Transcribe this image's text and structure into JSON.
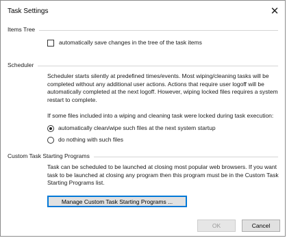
{
  "window": {
    "title": "Task Settings"
  },
  "items_tree": {
    "heading": "Items Tree",
    "autosave_label": "automatically save changes in the tree of the task items"
  },
  "scheduler": {
    "heading": "Scheduler",
    "description": "Scheduler starts silently at predefined times/events. Most wiping/cleaning tasks will be completed without any additional user actions. Actions that require user logoff will be automatically completed at the next logoff. However, wiping locked files requires a system restart to complete.",
    "locked_question": "If some files included into a wiping and cleaning task were locked during task execution:",
    "options": [
      {
        "label": "automatically clean/wipe such files at the next system startup",
        "selected": true
      },
      {
        "label": "do nothing with such files",
        "selected": false
      }
    ]
  },
  "custom_programs": {
    "heading": "Custom Task Starting Programs",
    "description": "Task can be scheduled to be launched at closing most popular web browsers. If you want task to be launched at closing any program then this program must be in the Custom Task Starting Programs list.",
    "manage_button": "Manage Custom Task Starting Programs ..."
  },
  "footer": {
    "ok_label": "OK",
    "cancel_label": "Cancel"
  }
}
